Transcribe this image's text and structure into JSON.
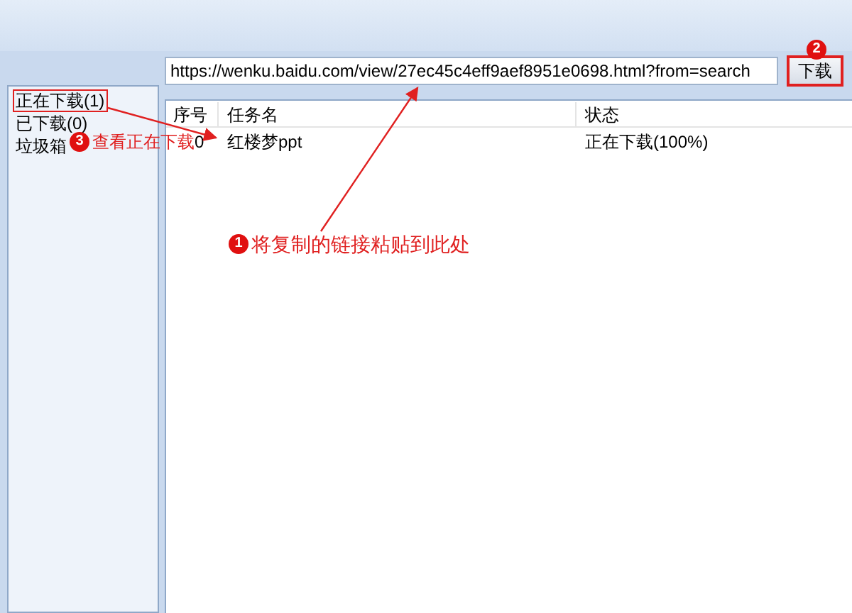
{
  "url_field": {
    "value": "https://wenku.baidu.com/view/27ec45c4eff9aef8951e0698.html?from=search"
  },
  "download_button": {
    "label": "下载"
  },
  "sidebar": {
    "items": [
      {
        "label": "正在下载(1)",
        "highlighted": true
      },
      {
        "label": "已下载(0)",
        "highlighted": false
      },
      {
        "label": "垃圾箱",
        "highlighted": false
      }
    ]
  },
  "table": {
    "columns": [
      "序号",
      "任务名",
      "状态"
    ],
    "rows": [
      [
        "0",
        "红楼梦ppt",
        "正在下载(100%)"
      ]
    ]
  },
  "annotations": [
    {
      "number": "1",
      "text": "将复制的链接粘贴到此处"
    },
    {
      "number": "2"
    },
    {
      "number": "3",
      "text": "查看正在下载"
    }
  ]
}
